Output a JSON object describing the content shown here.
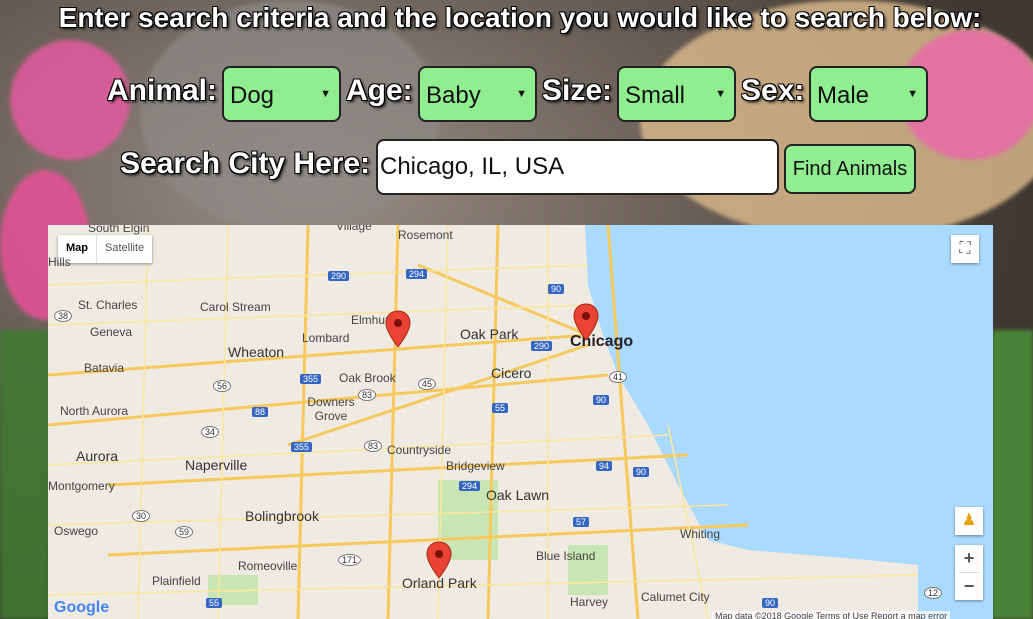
{
  "heading": "Enter search criteria and the location you would like to search below:",
  "filters": {
    "animal": {
      "label": "Animal:",
      "value": "Dog"
    },
    "age": {
      "label": "Age:",
      "value": "Baby"
    },
    "size": {
      "label": "Size:",
      "value": "Small"
    },
    "sex": {
      "label": "Sex:",
      "value": "Male"
    }
  },
  "search": {
    "label": "Search City Here:",
    "value": "Chicago, IL, USA",
    "button": "Find Animals"
  },
  "map": {
    "type_map": "Map",
    "type_satellite": "Satellite",
    "google": "Google",
    "attribution": "Map data ©2018 Google   Terms of Use   Report a map error",
    "labels": {
      "south_elgin": "South Elgin",
      "village": "Village",
      "hills": "Hills",
      "rosemont": "Rosemont",
      "st_charles": "St. Charles",
      "carol_stream": "Carol Stream",
      "elmhurst": "Elmhurst",
      "oak_park": "Oak Park",
      "chicago": "Chicago",
      "geneva": "Geneva",
      "lombard": "Lombard",
      "wheaton": "Wheaton",
      "batavia": "Batavia",
      "oak_brook": "Oak Brook",
      "cicero": "Cicero",
      "north_aurora": "North Aurora",
      "downers_grove": "Downers Grove",
      "aurora": "Aurora",
      "naperville": "Naperville",
      "countryside": "Countryside",
      "bridgeview": "Bridgeview",
      "montgomery": "Montgomery",
      "oak_lawn": "Oak Lawn",
      "oswego": "Oswego",
      "bolingbrook": "Bolingbrook",
      "whiting": "Whiting",
      "blue_island": "Blue Island",
      "romeoville": "Romeoville",
      "orland_park": "Orland Park",
      "plainfield": "Plainfield",
      "calumet_city": "Calumet City",
      "harvey": "Harvey"
    },
    "highways": [
      "290",
      "294",
      "90",
      "38",
      "290",
      "355",
      "56",
      "45",
      "41",
      "88",
      "83",
      "55",
      "90",
      "34",
      "355",
      "83",
      "94",
      "90",
      "294",
      "30",
      "59",
      "57",
      "171",
      "55",
      "90",
      "12"
    ]
  }
}
